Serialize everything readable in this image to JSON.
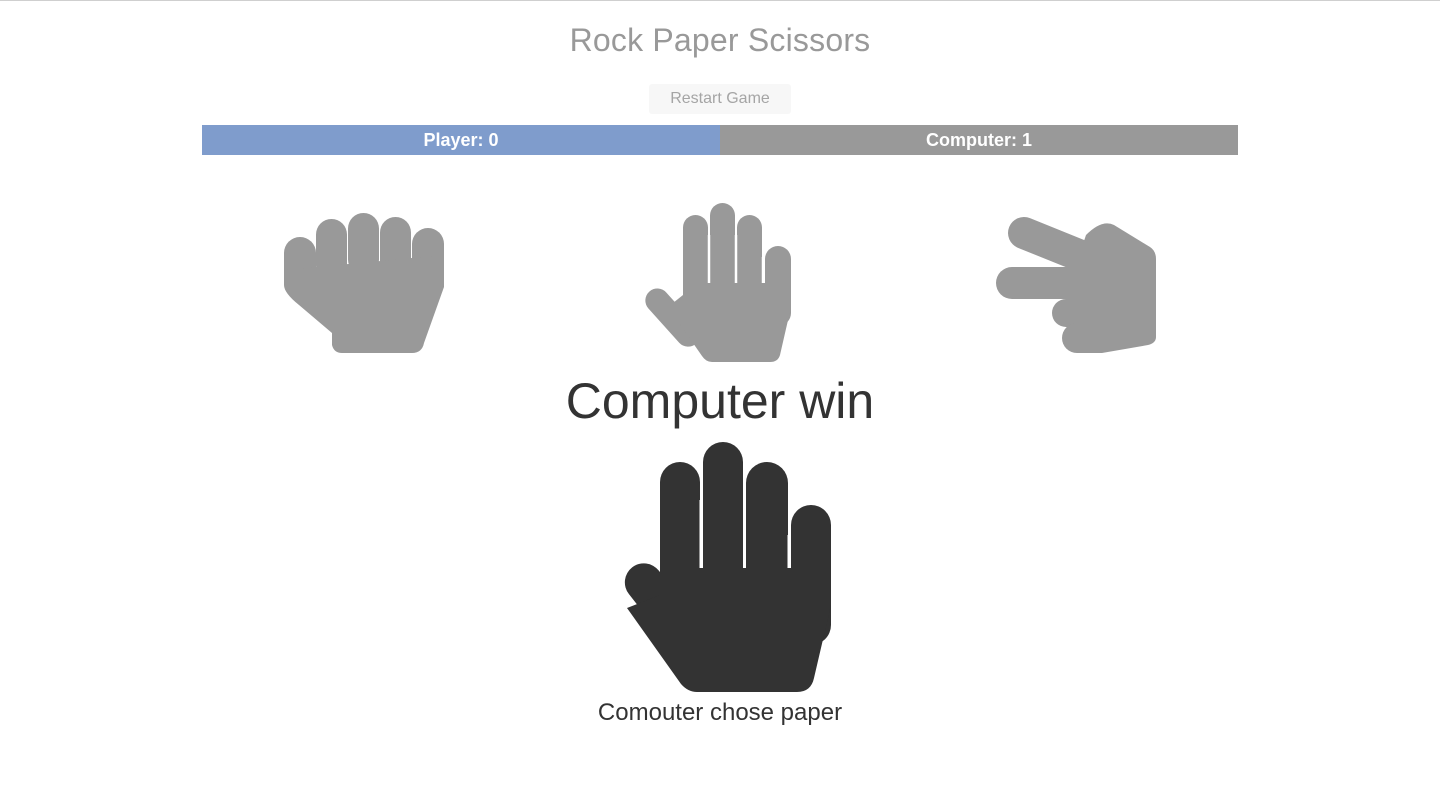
{
  "header": {
    "title": "Rock Paper Scissors",
    "restart_label": "Restart Game"
  },
  "scores": {
    "player_label": "Player: 0",
    "computer_label": "Computer: 1",
    "player": 0,
    "computer": 1
  },
  "choices": [
    {
      "name": "rock",
      "icon": "rock-hand-icon"
    },
    {
      "name": "paper",
      "icon": "paper-hand-icon"
    },
    {
      "name": "scissors",
      "icon": "scissors-hand-icon"
    }
  ],
  "result": {
    "message": "Computer win",
    "computer_choice_icon": "paper-hand-icon",
    "caption": "Comouter chose paper"
  },
  "colors": {
    "player_bar": "#7f9ccc",
    "computer_bar": "#999999",
    "choice_icon": "#999999",
    "result_icon": "#333333"
  }
}
